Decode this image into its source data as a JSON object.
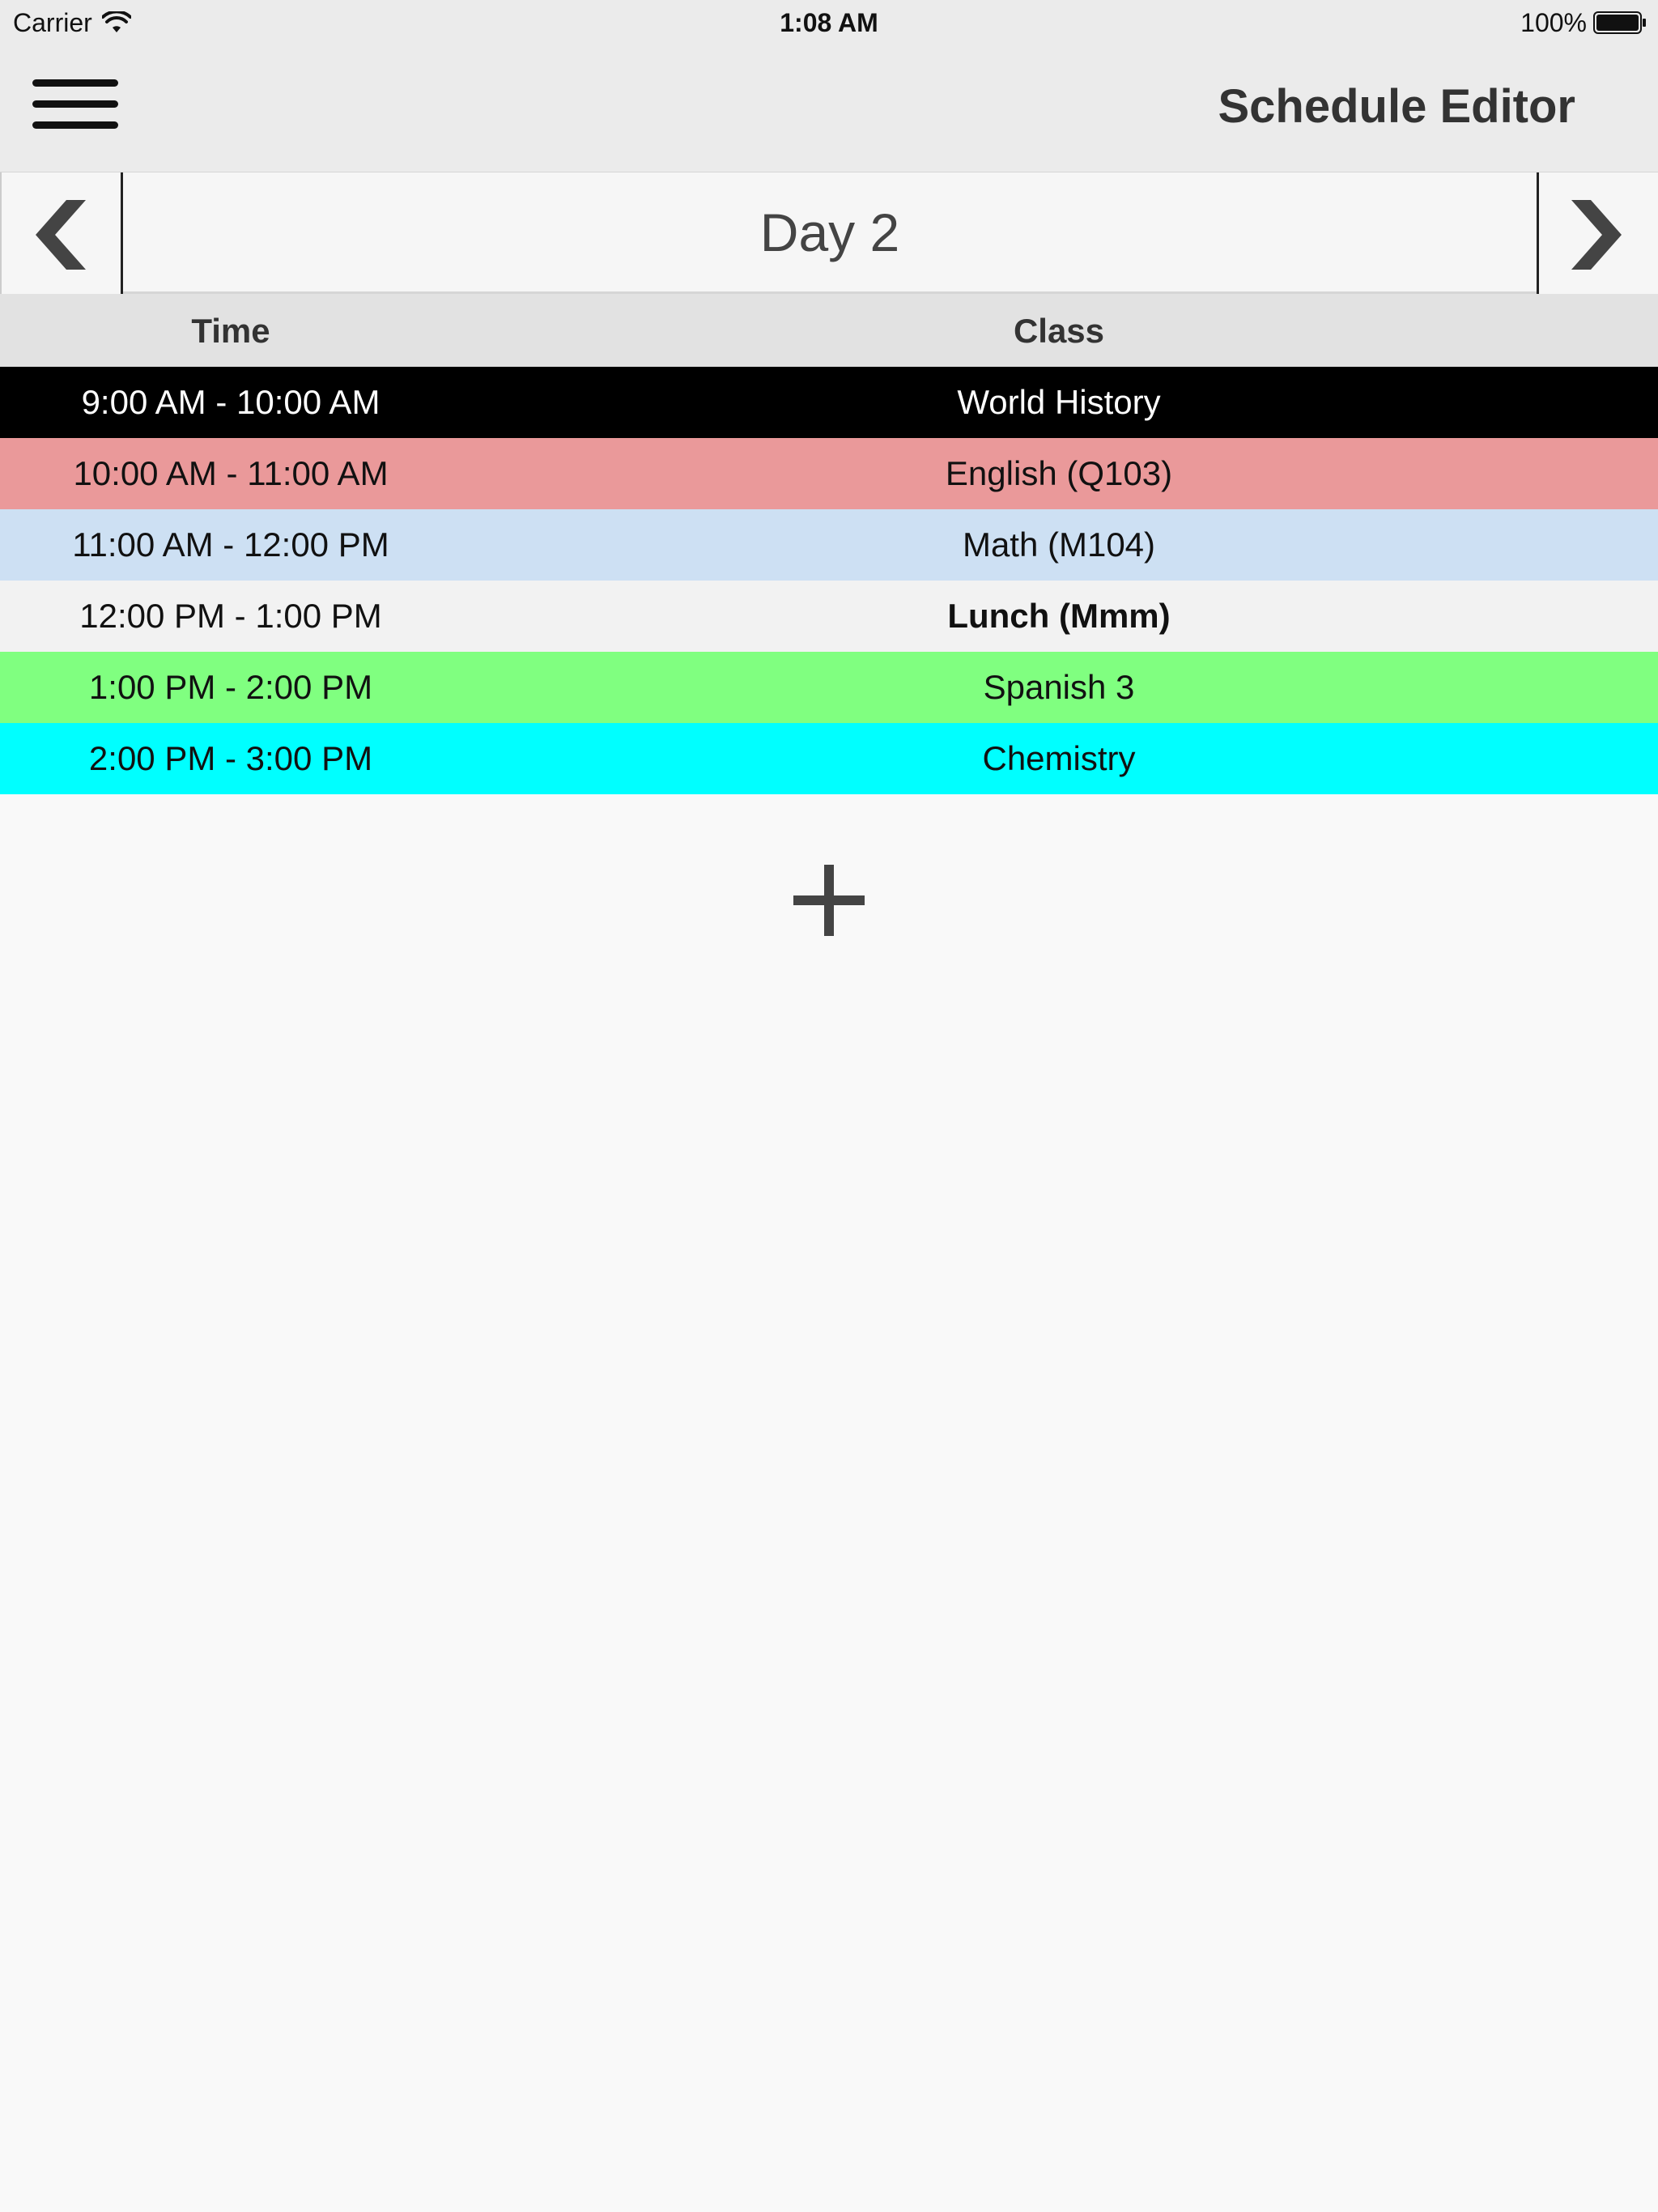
{
  "status_bar": {
    "carrier": "Carrier",
    "time": "1:08 AM",
    "battery": "100%"
  },
  "nav": {
    "title": "Schedule Editor",
    "menu_icon": "hamburger-menu-icon"
  },
  "day_nav": {
    "label": "Day 2",
    "prev_icon": "chevron-left-icon",
    "next_icon": "chevron-right-icon"
  },
  "table": {
    "headers": {
      "time": "Time",
      "class": "Class"
    },
    "rows": [
      {
        "time": "9:00 AM - 10:00 AM",
        "class": "World History",
        "color": "#000000"
      },
      {
        "time": "10:00 AM - 11:00 AM",
        "class": "English (Q103)",
        "color": "#ea999a"
      },
      {
        "time": "11:00 AM - 12:00 PM",
        "class": "Math (M104)",
        "color": "#cde0f3"
      },
      {
        "time": "12:00 PM - 1:00 PM",
        "class": "Lunch (Mmm)",
        "color": "#f2f2f2"
      },
      {
        "time": "1:00 PM - 2:00 PM",
        "class": "Spanish 3",
        "color": "#80ff80"
      },
      {
        "time": "2:00 PM - 3:00 PM",
        "class": "Chemistry",
        "color": "#00ffff"
      }
    ]
  },
  "add_icon": "plus-icon"
}
